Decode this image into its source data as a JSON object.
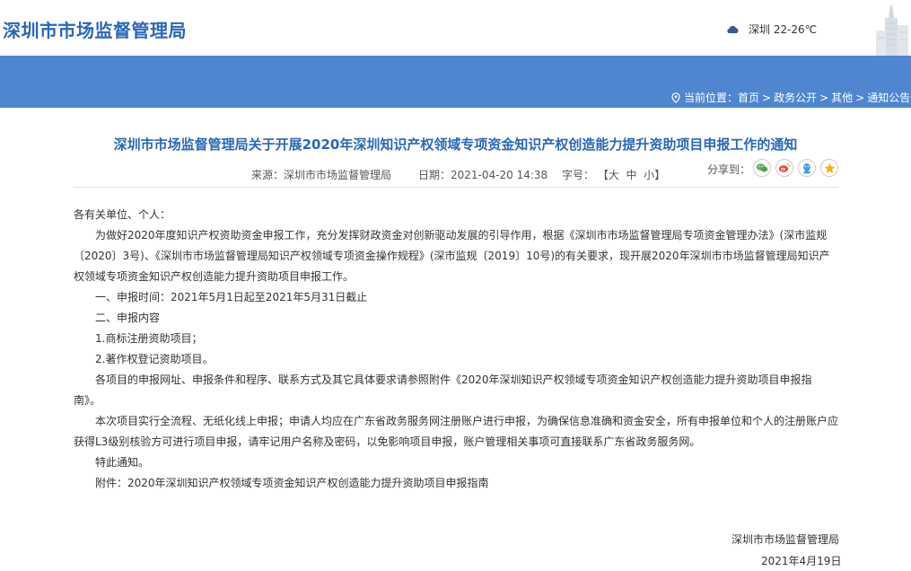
{
  "header": {
    "site_title": "深圳市市场监督管理局",
    "weather": "深圳 22-26℃",
    "weather_icon": "cloud-icon"
  },
  "breadcrumb": {
    "prefix": "当前位置：",
    "items": [
      "首页",
      "政务公开",
      "其他",
      "通知公告"
    ],
    "separator": ">"
  },
  "article": {
    "title": "深圳市市场监督管理局关于开展2020年深圳知识产权领域专项资金知识产权创造能力提升资助项目申报工作的通知",
    "source_label": "来源：",
    "source": "深圳市市场监督管理局",
    "date_label": "日期：",
    "date": "2021-04-20 14:38",
    "font_label": "字号：",
    "font_open": "【",
    "font_large": "大",
    "font_medium": "中",
    "font_small": "小",
    "font_close": "】",
    "share_label": "分享到：",
    "paragraphs": [
      "各有关单位、个人：",
      "为做好2020年度知识产权资助资金申报工作，充分发挥财政资金对创新驱动发展的引导作用，根据《深圳市市场监督管理局专项资金管理办法》(深市监规〔2020〕3号)、《深圳市市场监督管理局知识产权领域专项资金操作规程》(深市监规〔2019〕10号)的有关要求，现开展2020年深圳市市场监督管理局知识产权领域专项资金知识产权创造能力提升资助项目申报工作。",
      "一、申报时间：2021年5月1日起至2021年5月31日截止",
      "二、申报内容",
      "1.商标注册资助项目；",
      "2.著作权登记资助项目。",
      "各项目的申报网址、申报条件和程序、联系方式及其它具体要求请参照附件《2020年深圳知识产权领域专项资金知识产权创造能力提升资助项目申报指南》。",
      "本次项目实行全流程、无纸化线上申报；申请人均应在广东省政务服务网注册账户进行申报，为确保信息准确和资金安全，所有申报单位和个人的注册账户应获得L3级别核验方可进行项目申报，请牢记用户名称及密码，以免影响项目申报，账户管理相关事项可直接联系广东省政务服务网。",
      "特此通知。",
      "附件：2020年深圳知识产权领域专项资金知识产权创造能力提升资助项目申报指南"
    ],
    "signature_org": "深圳市市场监督管理局",
    "signature_date": "2021年4月19日"
  },
  "colors": {
    "brand_blue": "#2a66b8",
    "banner_blue": "#4f86cf"
  }
}
